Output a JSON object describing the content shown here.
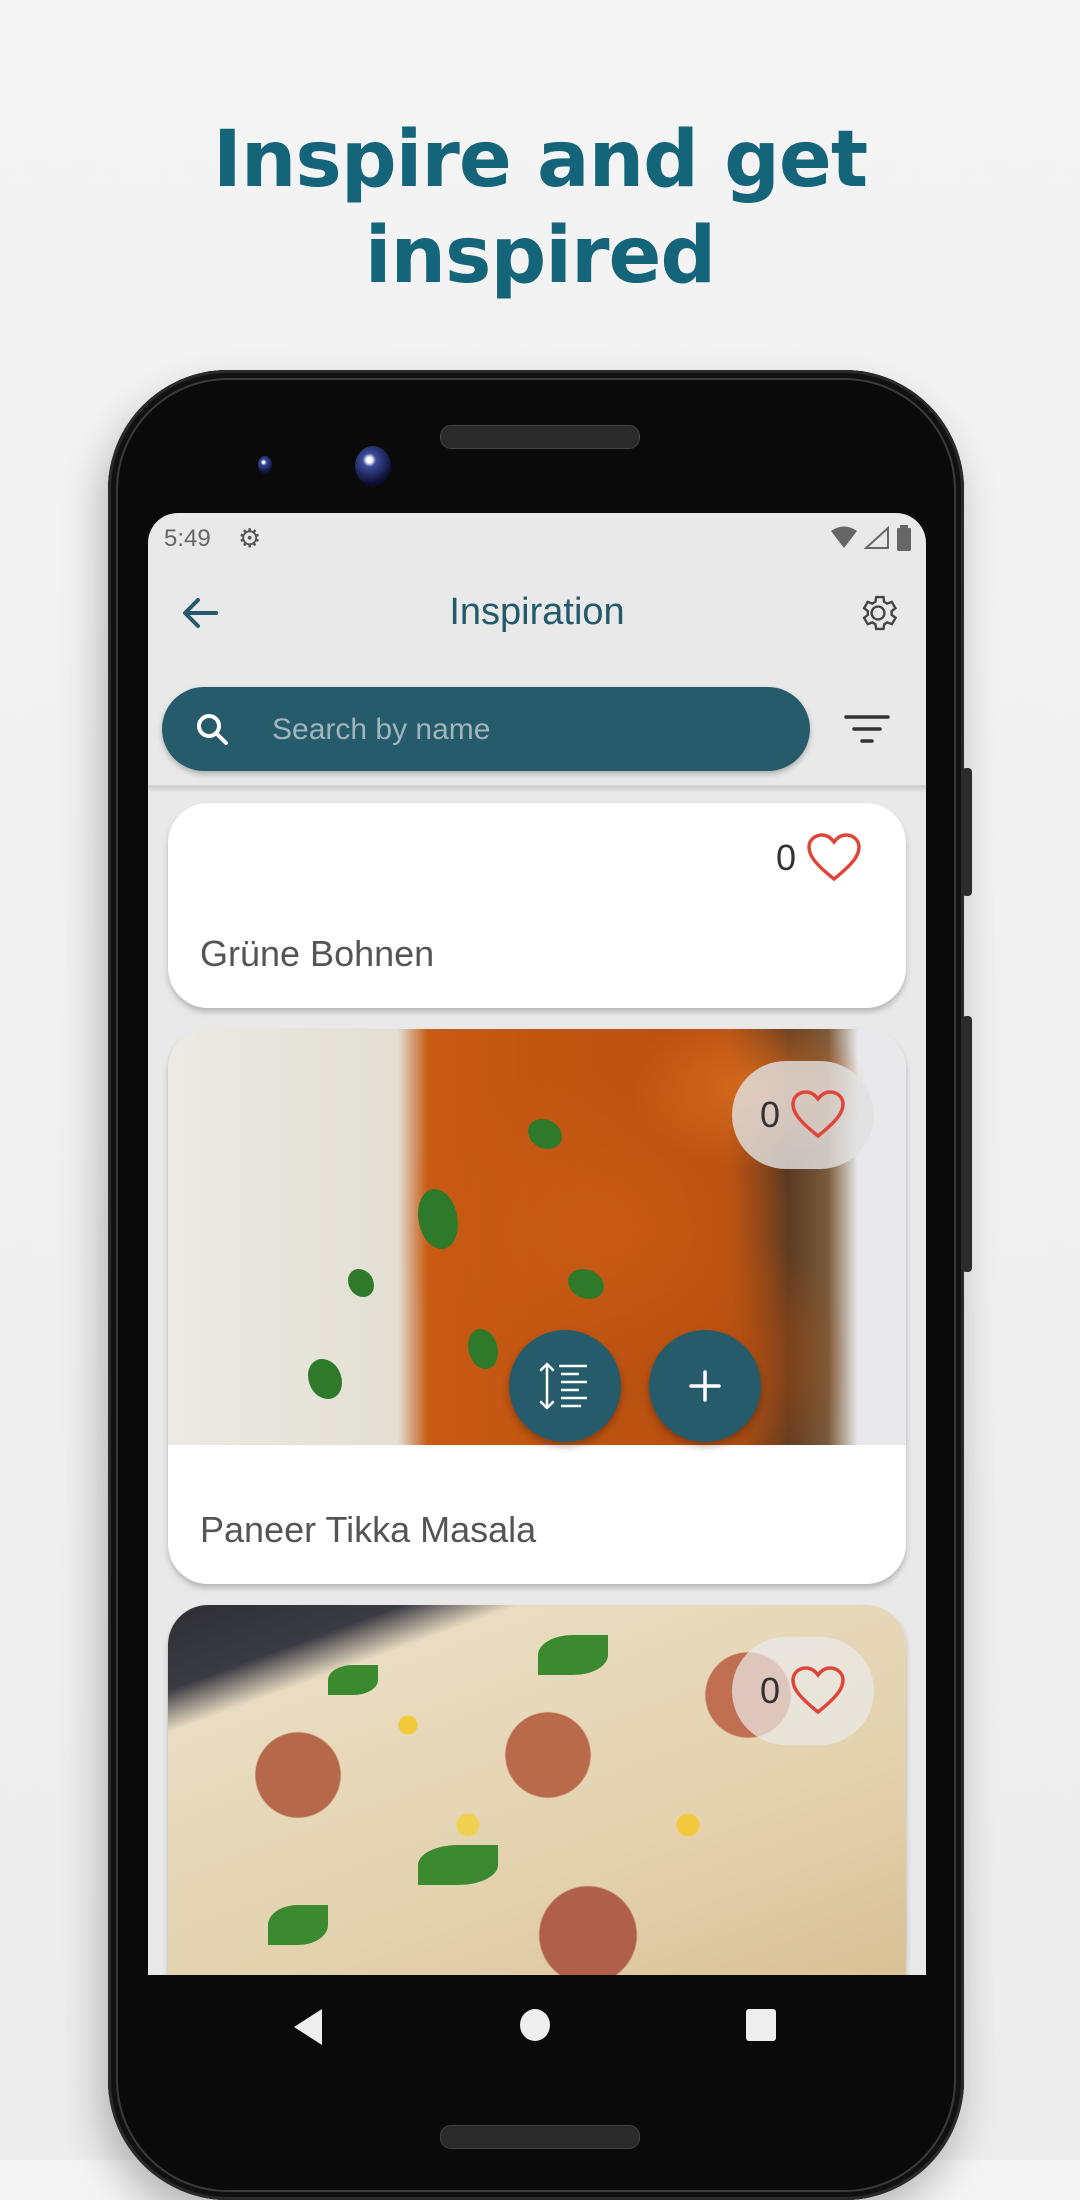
{
  "headline": {
    "line1": "Inspire and get",
    "line2": "inspired"
  },
  "status_bar": {
    "time": "5:49",
    "icons": [
      "settings-icon",
      "wifi-icon",
      "signal-icon",
      "battery-icon"
    ]
  },
  "app_bar": {
    "title": "Inspiration",
    "left_icon": "back-arrow-icon",
    "right_icon": "settings-gear-icon"
  },
  "search": {
    "placeholder": "Search by name",
    "value": "",
    "icon": "search-icon",
    "filter_icon": "filter-icon"
  },
  "colors": {
    "brand": "#265b6b",
    "headline": "#14647a",
    "heart": "#e0453a",
    "card_text": "#555555"
  },
  "recipes": [
    {
      "name": "Grüne Bohnen",
      "likes": "0",
      "has_image": false
    },
    {
      "name": "Paneer Tikka Masala",
      "likes": "0",
      "has_image": true
    },
    {
      "name": "",
      "likes": "0",
      "has_image": true
    }
  ],
  "fabs": [
    {
      "icon": "sort-list-icon"
    },
    {
      "icon": "add-icon",
      "label": "+"
    }
  ],
  "nav": {
    "buttons": [
      "back",
      "home",
      "recents"
    ]
  }
}
